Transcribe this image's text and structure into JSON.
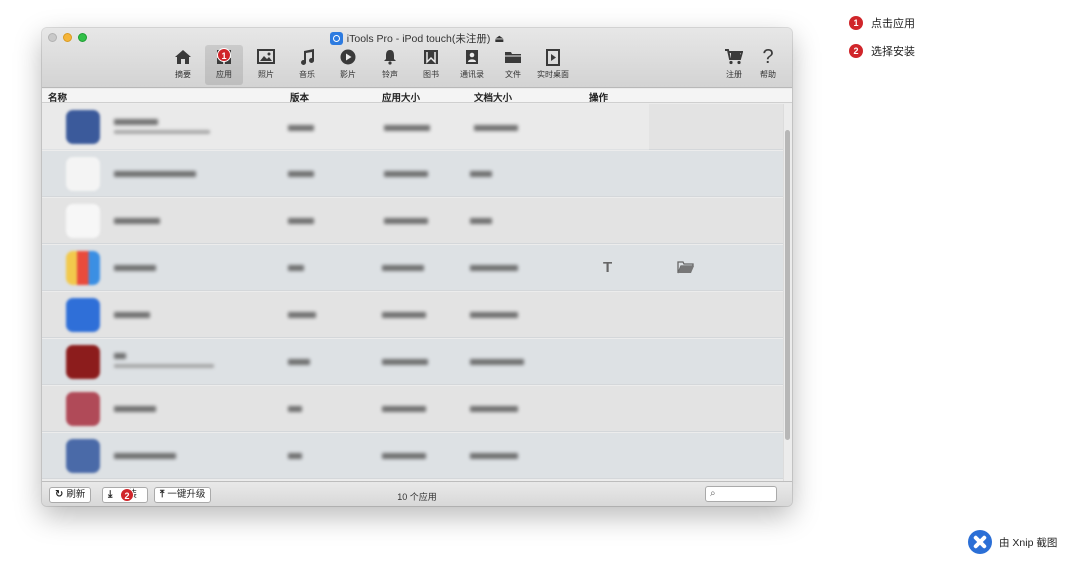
{
  "window": {
    "title": "iTools Pro - iPod touch(未注册)",
    "eject_symbol": "⏏"
  },
  "toolbar": {
    "items": [
      {
        "label": "摘要",
        "icon": "home-icon"
      },
      {
        "label": "应用",
        "icon": "apps-icon"
      },
      {
        "label": "照片",
        "icon": "photo-icon"
      },
      {
        "label": "音乐",
        "icon": "music-icon"
      },
      {
        "label": "影片",
        "icon": "play-icon"
      },
      {
        "label": "铃声",
        "icon": "bell-icon"
      },
      {
        "label": "图书",
        "icon": "book-icon"
      },
      {
        "label": "通讯录",
        "icon": "contacts-icon"
      },
      {
        "label": "文件",
        "icon": "folder-icon"
      },
      {
        "label": "实时桌面",
        "icon": "screen-icon"
      }
    ],
    "right": [
      {
        "label": "注册",
        "icon": "cart-icon"
      },
      {
        "label": "帮助",
        "icon": "help-icon"
      }
    ]
  },
  "columns": {
    "name": "名称",
    "version": "版本",
    "app_size": "应用大小",
    "doc_size": "文档大小",
    "actions": "操作"
  },
  "bottom": {
    "refresh_label": "刷新",
    "install_label": "装",
    "upgrade_label": "一键升级",
    "count_label": "10 个应用"
  },
  "annotations": {
    "badge1": "1",
    "badge2": "2",
    "step1": "点击应用",
    "step2": "选择安装"
  },
  "watermark": "由 Xnip 截图",
  "colors": {
    "badge_red": "#d0252a",
    "row_alt": "#dde1e4",
    "row_base": "#e3e3e3"
  }
}
